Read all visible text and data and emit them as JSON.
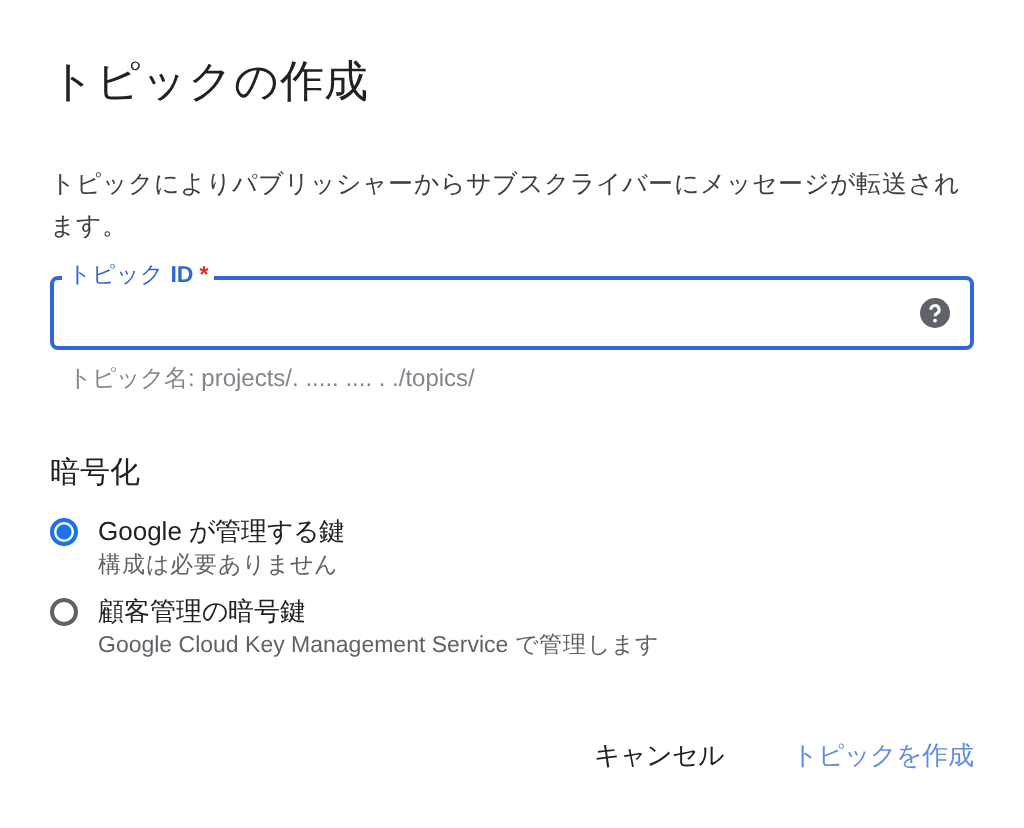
{
  "dialog": {
    "title": "トピックの作成",
    "description": "トピックによりパブリッシャーからサブスクライバーにメッセージが転送されます。",
    "field": {
      "label": "トピック **ID**",
      "required_mark": "*",
      "focused": true,
      "helper": "トピック名: projects/. ..... .... . ./topics/"
    },
    "encryption": {
      "heading": "暗号化",
      "options": [
        {
          "label": "Google が管理する鍵",
          "description": "構成は必要ありません",
          "selected": true
        },
        {
          "label": "顧客管理の暗号鍵",
          "description": "Google Cloud Key Management Service で管理します",
          "selected": false
        }
      ]
    },
    "buttons": [
      {
        "label": "キャンセル",
        "kind": "secondary"
      },
      {
        "label": "トピックを作成",
        "kind": "primary"
      }
    ]
  }
}
